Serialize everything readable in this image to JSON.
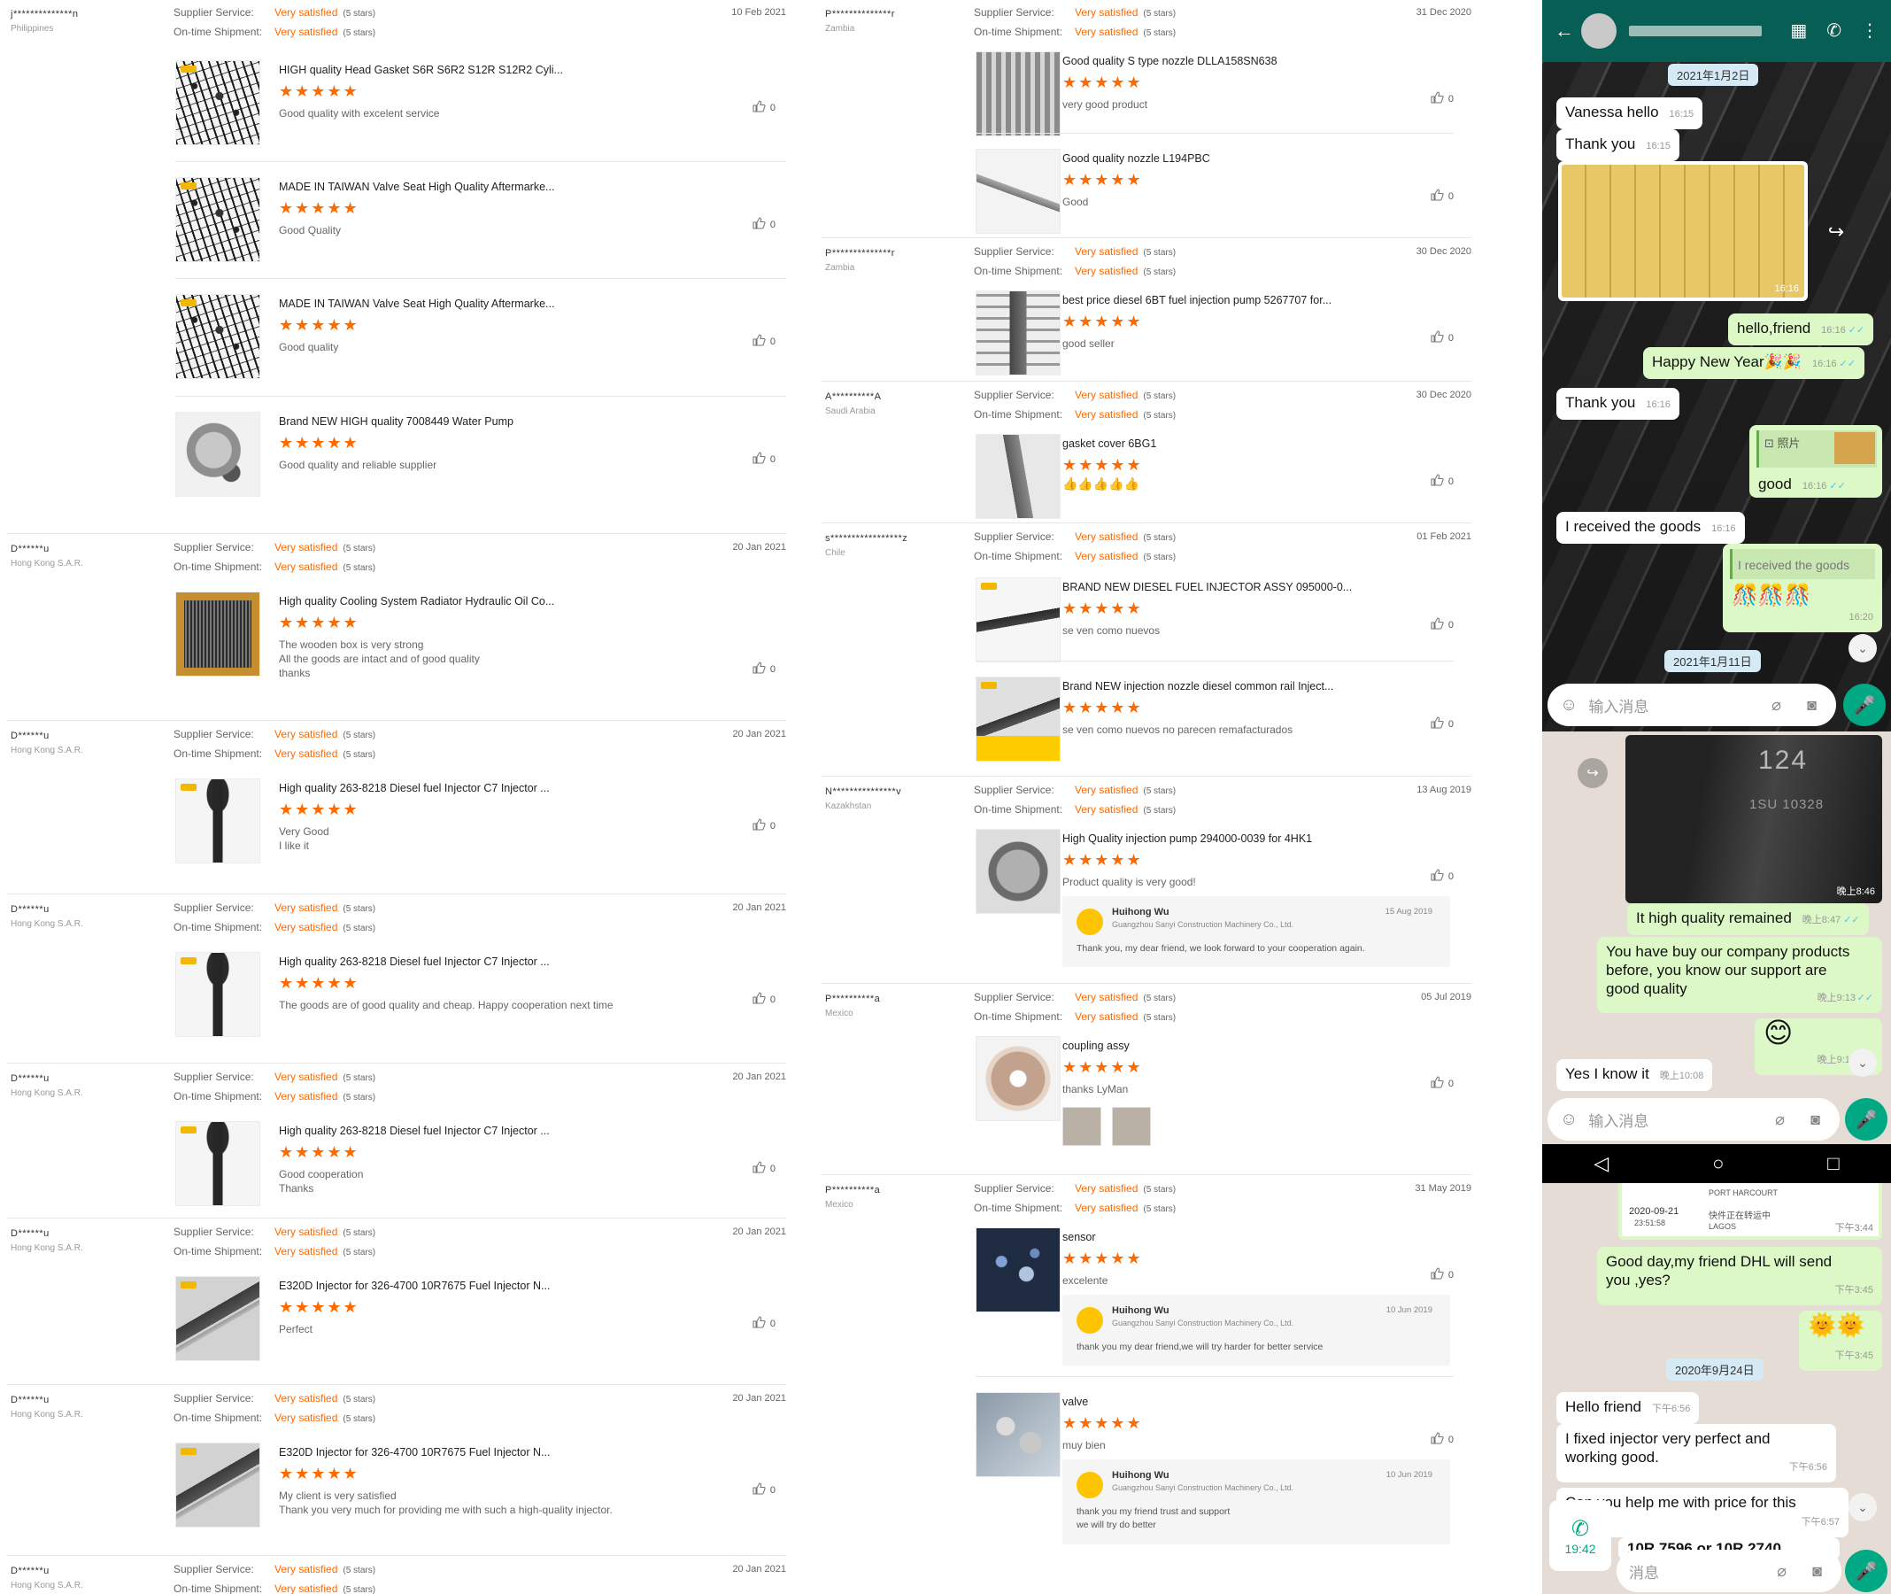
{
  "labels": {
    "supplier_service": "Supplier Service:",
    "ontime_shipment": "On-time Shipment:",
    "very_satisfied": "Very satisfied",
    "five_stars": "(5 stars)",
    "stars": "★★★★★",
    "like_count": "0"
  },
  "left_feed": [
    {
      "buyer": "j**************n",
      "country": "Philippines",
      "date": "10 Feb 2021",
      "items": [
        {
          "title": "HIGH quality Head Gasket S6R S6R2 S12R S12R2 Cyli...",
          "comment": [
            "Good quality with excelent service"
          ],
          "img": "img-gasket"
        },
        {
          "title": "MADE IN TAIWAN Valve Seat High Quality Aftermarke...",
          "comment": [
            "Good Quality"
          ],
          "img": "img-gasket"
        },
        {
          "title": "MADE IN TAIWAN Valve Seat High Quality Aftermarke...",
          "comment": [
            "Good quality"
          ],
          "img": "img-gasket"
        },
        {
          "title": "Brand NEW HIGH quality 7008449 Water Pump",
          "comment": [
            "Good quality and reliable supplier"
          ],
          "img": "img-pump"
        }
      ]
    },
    {
      "buyer": "D******u",
      "country": "Hong Kong S.A.R.",
      "date": "20 Jan 2021",
      "items": [
        {
          "title": "High quality Cooling System Radiator Hydraulic Oil Co...",
          "comment": [
            "The wooden box is very strong",
            "All the goods are intact and of good quality",
            "thanks"
          ],
          "img": "img-radiator"
        }
      ]
    },
    {
      "buyer": "D******u",
      "country": "Hong Kong S.A.R.",
      "date": "20 Jan 2021",
      "items": [
        {
          "title": "High quality 263-8218 Diesel fuel Injector C7 Injector ...",
          "comment": [
            "Very Good",
            "I like it"
          ],
          "img": "img-injector"
        }
      ]
    },
    {
      "buyer": "D******u",
      "country": "Hong Kong S.A.R.",
      "date": "20 Jan 2021",
      "items": [
        {
          "title": "High quality 263-8218 Diesel fuel Injector C7 Injector ...",
          "comment": [
            "The goods are of good quality and cheap.  Happy cooperation next time"
          ],
          "img": "img-injector"
        }
      ]
    },
    {
      "buyer": "D******u",
      "country": "Hong Kong S.A.R.",
      "date": "20 Jan 2021",
      "items": [
        {
          "title": "High quality 263-8218 Diesel fuel Injector C7 Injector ...",
          "comment": [
            "Good cooperation",
            "Thanks"
          ],
          "img": "img-injector"
        }
      ]
    },
    {
      "buyer": "D******u",
      "country": "Hong Kong S.A.R.",
      "date": "20 Jan 2021",
      "items": [
        {
          "title": "E320D Injector for 326-4700 10R7675 Fuel Injector N...",
          "comment": [
            "Perfect"
          ],
          "img": "img-injector2"
        }
      ]
    },
    {
      "buyer": "D******u",
      "country": "Hong Kong S.A.R.",
      "date": "20 Jan 2021",
      "items": [
        {
          "title": "E320D Injector for 326-4700 10R7675 Fuel Injector N...",
          "comment": [
            "My client is very satisfied",
            "Thank you very much for providing me with such a high-quality injector."
          ],
          "img": "img-injector2"
        }
      ]
    },
    {
      "buyer": "D******u",
      "country": "Hong Kong S.A.R.",
      "date": "20 Jan 2021",
      "items": []
    }
  ],
  "middle_feed": [
    {
      "buyer": "P**************r",
      "country": "Zambia",
      "date": "31 Dec 2020",
      "items": [
        {
          "title": "Good quality S type nozzle DLLA158SN638",
          "comment": [
            "very good product"
          ],
          "img": "img-nozzles"
        },
        {
          "title": "Good quality nozzle L194PBC",
          "comment": [
            "Good"
          ],
          "img": "img-nozzle1"
        }
      ]
    },
    {
      "buyer": "P**************r",
      "country": "Zambia",
      "date": "30 Dec 2020",
      "items": [
        {
          "title": "best price diesel 6BT fuel injection pump 5267707 for...",
          "comment": [
            "good seller"
          ],
          "img": "img-pump2"
        }
      ]
    },
    {
      "buyer": "A**********A",
      "country": "Saudi Arabia",
      "date": "30 Dec 2020",
      "items": [
        {
          "title": "gasket cover 6BG1",
          "comment": [],
          "emoji": "👍👍👍👍👍",
          "img": "img-cover"
        }
      ]
    },
    {
      "buyer": "s*****************z",
      "country": "Chile",
      "date": "01 Feb 2021",
      "items": [
        {
          "title": "BRAND NEW DIESEL FUEL INJECTOR ASSY 095000-0...",
          "comment": [
            "se ven como nuevos"
          ],
          "img": "img-inj3"
        },
        {
          "title": "Brand NEW injection nozzle diesel common rail Inject...",
          "comment": [
            "se ven como nuevos no parecen remafacturados"
          ],
          "img": "img-inj4"
        }
      ]
    },
    {
      "buyer": "N***************v",
      "country": "Kazakhstan",
      "date": "13 Aug 2019",
      "items": [
        {
          "title": "High Quality injection pump 294000-0039 for 4HK1",
          "comment": [
            "Product quality is very good!"
          ],
          "img": "img-hppump",
          "reply": {
            "name": "Huihong Wu",
            "company": "Guangzhou Sanyi Construction Machinery Co., Ltd.",
            "date": "15 Aug 2019",
            "text": [
              "Thank you, my dear friend, we look forward to your cooperation again."
            ]
          }
        }
      ]
    },
    {
      "buyer": "P**********a",
      "country": "Mexico",
      "date": "05 Jul 2019",
      "items": [
        {
          "title": "coupling assy",
          "comment": [
            "thanks  LyMan"
          ],
          "img": "img-coupling",
          "photos": 2
        }
      ]
    },
    {
      "buyer": "P**********a",
      "country": "Mexico",
      "date": "31 May 2019",
      "items": [
        {
          "title": "sensor",
          "comment": [
            "excelente"
          ],
          "img": "img-sensor",
          "reply": {
            "name": "Huihong Wu",
            "company": "Guangzhou Sanyi Construction Machinery Co., Ltd.",
            "date": "10 Jun 2019",
            "text": [
              "thank you my dear friend,we will try harder for better service"
            ]
          }
        },
        {
          "title": "valve",
          "comment": [
            "muy bien"
          ],
          "img": "img-valve",
          "reply": {
            "name": "Huihong Wu",
            "company": "Guangzhou Sanyi Construction Machinery Co., Ltd.",
            "date": "10 Jun 2019",
            "text": [
              "thank you my friend trust and support",
              "we will try do better"
            ]
          }
        }
      ]
    }
  ],
  "chat1": {
    "date1": "2021年1月2日",
    "m1": {
      "text": "Vanessa hello",
      "time": "16:15"
    },
    "m2": {
      "text": "Thank you",
      "time": "16:15"
    },
    "photo_time": "16:16",
    "m3": {
      "text": "hello,friend",
      "time": "16:16"
    },
    "m4": {
      "text": "Happy New Year🎉🎉",
      "time": "16:16"
    },
    "m5": {
      "text": "Thank you",
      "time": "16:16"
    },
    "m6_photo_label": "⊡ 照片",
    "m6": {
      "text": "good",
      "time": "16:16"
    },
    "m7": {
      "text": "I received the goods",
      "time": "16:16"
    },
    "m8": {
      "text": "I received the goods",
      "emoji": "🎊🎊🎊",
      "time": "16:20"
    },
    "date2": "2021年1月11日",
    "input_placeholder": "输入消息"
  },
  "chat2": {
    "photo_line1": "124",
    "photo_line2": "1SU 10328",
    "photo_time": "晚上8:46",
    "m1": {
      "text": "It high quality remained",
      "time": "晚上8:47"
    },
    "m2": {
      "lines": [
        "You have buy our company products",
        "before, you know our support are",
        "good quality"
      ],
      "time": "晚上9:13"
    },
    "m3": {
      "text": "😊",
      "time": "晚上9:13"
    },
    "m4": {
      "text": "Yes I know it",
      "time": "晚上10:08"
    },
    "input_placeholder": "输入消息"
  },
  "nav": {
    "back": "◁",
    "home": "○",
    "recent": "□"
  },
  "chat3": {
    "top_date": "2020-09-21",
    "top_time": "23:51:58",
    "top_city1": "PORT HARCOURT",
    "top_city2": "LAGOS",
    "top_status": "快件正在转运中",
    "top_stamp": "下午3:44",
    "m1": {
      "lines": [
        "Good day,my friend DHL will send",
        "you ,yes?"
      ],
      "time": "下午3:45"
    },
    "m2": {
      "text": "🌞🌞",
      "time": "下午3:45"
    },
    "date": "2020年9月24日",
    "m3": {
      "text": "Hello friend",
      "time": "下午6:56"
    },
    "m4": {
      "lines": [
        "I fixed injector very perfect and",
        "working good."
      ],
      "time": "下午6:56"
    },
    "m5": {
      "text": "Can you help me with price for this",
      "time": "下午6:57"
    },
    "m6": {
      "text": "10R 7596 or 10R 2740"
    },
    "call_time": "19:42",
    "input_placeholder": "消息"
  }
}
